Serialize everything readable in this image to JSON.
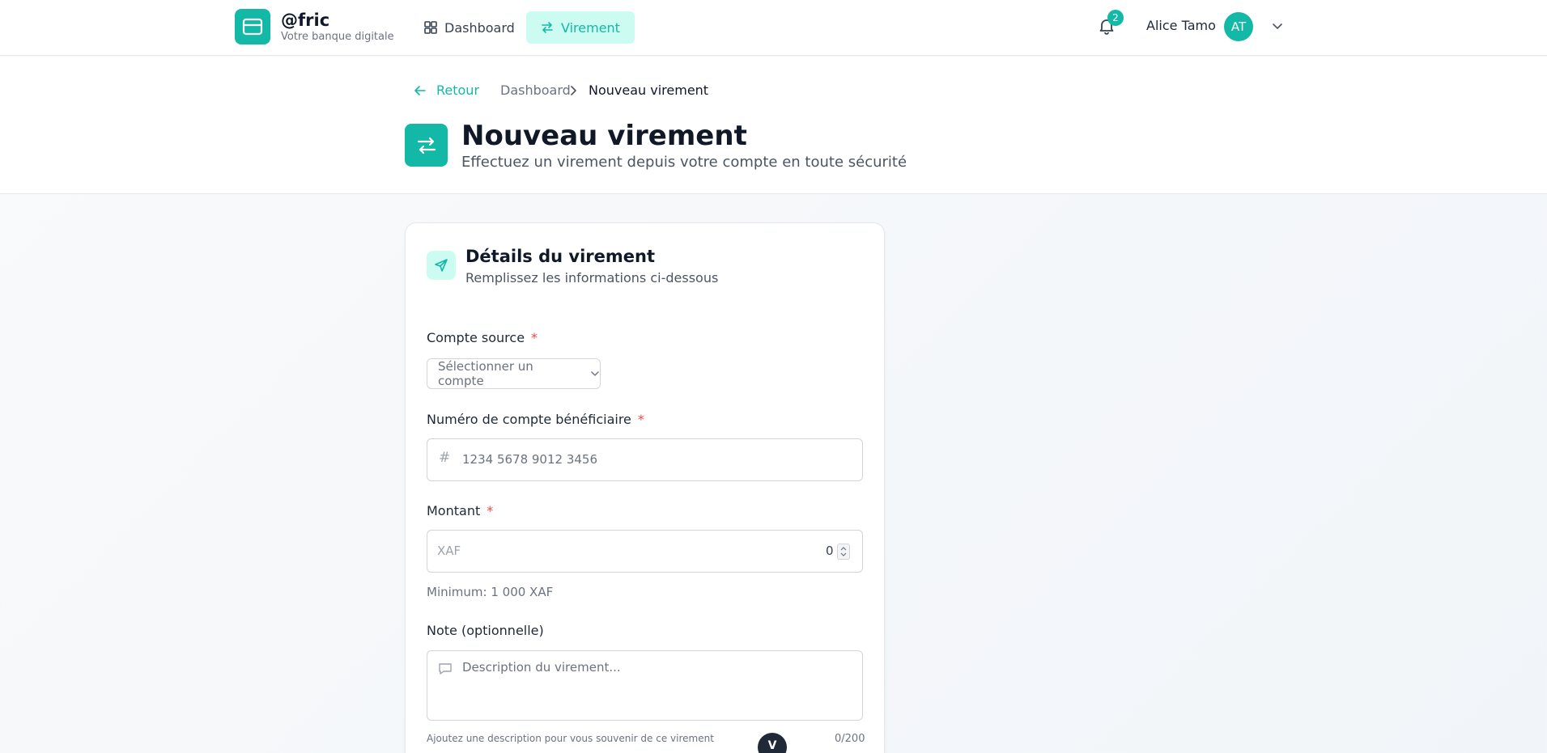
{
  "brand": {
    "name": "@fric",
    "tagline": "Votre banque digitale"
  },
  "nav": {
    "items": [
      {
        "label": "Dashboard",
        "icon": "grid-icon"
      },
      {
        "label": "Virement",
        "icon": "transfer-icon",
        "active": true
      }
    ]
  },
  "user": {
    "notifications": "2",
    "name": "Alice Tamo",
    "initials": "AT"
  },
  "breadcrumb": {
    "back": "Retour",
    "parent": "Dashboard",
    "current": "Nouveau virement"
  },
  "page": {
    "title": "Nouveau virement",
    "subtitle": "Effectuez un virement depuis votre compte en toute sécurité"
  },
  "form": {
    "title": "Détails du virement",
    "subtitle": "Remplissez les informations ci-dessous",
    "required_mark": "*",
    "source": {
      "label": "Compte source",
      "placeholder": "Sélectionner un compte"
    },
    "beneficiary": {
      "label": "Numéro de compte bénéficiaire",
      "prefix": "#",
      "placeholder": "1234 5678 9012 3456"
    },
    "amount": {
      "label": "Montant",
      "currency": "XAF",
      "value": "0",
      "helper": "Minimum: 1 000 XAF"
    },
    "note": {
      "label": "Note (optionnelle)",
      "placeholder": "Description du virement...",
      "helper": "Ajoutez une description pour vous souvenir de ce virement",
      "counter": "0/200"
    }
  },
  "floating_button": {
    "label": "V"
  },
  "colors": {
    "accent": "#14b8a6",
    "accent_light": "#ccfbf1",
    "required": "#ef4444"
  }
}
